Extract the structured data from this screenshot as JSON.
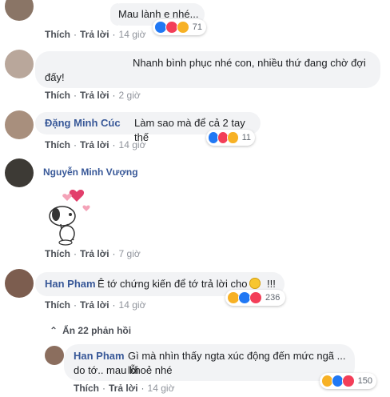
{
  "comments": [
    {
      "author": "",
      "text": "Mau lành e nhé...",
      "actions": {
        "like": "Thích",
        "reply": "Trả lời",
        "time": "14 giờ"
      },
      "reactions": {
        "icons": [
          "like-icon",
          "love-icon",
          "haha-icon"
        ],
        "count": "71"
      }
    },
    {
      "author": "",
      "text_line1": "Nhanh bình phục nhé con, nhiều thứ đang chờ đợi",
      "text_line2": "đấy!",
      "actions": {
        "like": "Thích",
        "reply": "Trả lời",
        "time": "2 giờ"
      }
    },
    {
      "author": "Đặng Minh Cúc",
      "text": "Làm sao mà để cả 2 tay thế",
      "actions": {
        "like": "Thích",
        "reply": "Trả lời",
        "time": "14 giờ"
      },
      "reactions": {
        "icons": [
          "like-icon",
          "love-icon",
          "sad-icon"
        ],
        "count": "11"
      }
    },
    {
      "author": "Nguyễn Minh Vượng",
      "sticker": "snoopy-hearts-sticker",
      "actions": {
        "like": "Thích",
        "reply": "Trả lời",
        "time": "7 giờ"
      }
    },
    {
      "author": "Han Pham",
      "text": "Ê tớ chứng kiến để tớ trả lời cho",
      "text_end": "!!!",
      "actions": {
        "like": "Thích",
        "reply": "Trả lời",
        "time": "14 giờ"
      },
      "reactions": {
        "icons": [
          "haha-icon",
          "like-icon",
          "love-icon"
        ],
        "count": "236"
      }
    }
  ],
  "hide_replies": {
    "label": "Ẩn 22 phản hồi"
  },
  "reply": {
    "author": "Han Pham",
    "text_line1": "Gì mà nhìn thấy ngta xúc động đến mức ngã ... lỗi",
    "text_line2": "do tớ.. mau khoẻ nhé",
    "actions": {
      "like": "Thích",
      "reply": "Trả lời",
      "time": "14 giờ"
    },
    "reactions": {
      "icons": [
        "haha-icon",
        "like-icon",
        "love-icon"
      ],
      "count": "150"
    }
  },
  "colors": {
    "author": "#385898",
    "bubble": "#f2f3f5",
    "like": "#2078f4",
    "love": "#f33e58",
    "haha": "#f7b125"
  }
}
